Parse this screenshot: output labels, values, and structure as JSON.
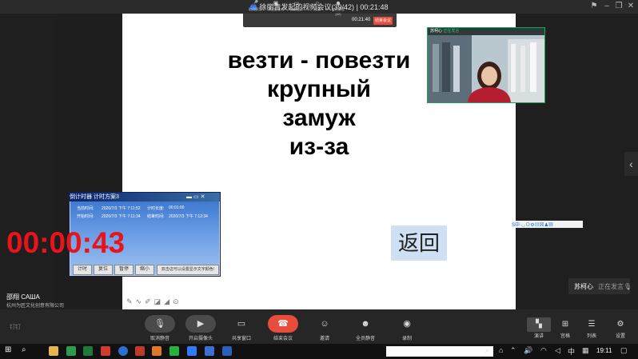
{
  "window": {
    "title": "徐丽青发起的视频会议(39/42)",
    "separator": "|",
    "elapsed": "00:21:48",
    "controls": [
      "⚑",
      "–",
      "❐",
      "✕"
    ]
  },
  "mini_toolbar": {
    "buttons": [
      "取消静音",
      "开启摄像头",
      "共享窗口",
      "成员",
      "全员静音(42)"
    ],
    "time": "00:21:40",
    "end_label": "结束会议"
  },
  "slide": {
    "lines": [
      "везти - повезти",
      "крупный",
      "замуж",
      "из-за"
    ],
    "return_label": "返回",
    "pen_tools": "✎∿✐◪◢⊙"
  },
  "video": {
    "name": "苏柯心",
    "status": "正在发言"
  },
  "timer": {
    "title": "倒计时器  计时方案3",
    "rows": [
      {
        "l1": "当前时间:",
        "v1": "2020/7/3 下午 7:11:52",
        "l2": "计时长度:",
        "v2": "00:01:00"
      },
      {
        "l1": "开始时间:",
        "v1": "2020/7/3 下午 7:11:34",
        "l2": "结束时间:",
        "v2": "2020/7/3 下午 7:12:34"
      }
    ],
    "digits": "00:00:43",
    "buttons": [
      "计时",
      "复位",
      "暂停",
      "缩小"
    ],
    "hint": "双击这可以设置显示文字颜色!"
  },
  "host": {
    "name": "邵翔 САША",
    "org": "杭州为匠文化创意有限公司"
  },
  "speaking": {
    "name": "苏柯心",
    "state": "正在发言"
  },
  "ime": "S中·◡⊙⚙▤⊠♟▦",
  "brand": "钉钉",
  "toolbar": {
    "unmute": "取消静音",
    "camera": "开启摄像头",
    "share": "共享窗口",
    "end": "结束会议",
    "invite": "邀请",
    "mute_all": "全员静音",
    "record": "录制"
  },
  "views": {
    "speaker": "演讲",
    "grid": "宫格",
    "list": "列表",
    "settings": "设置"
  },
  "taskbar": {
    "ime": "中",
    "clock": "19:11"
  },
  "colors": {
    "accent_red": "#e84c3d",
    "timer_digits": "#e8141c",
    "return_btn": "#cfe0f4",
    "video_border": "#1aa35a"
  }
}
